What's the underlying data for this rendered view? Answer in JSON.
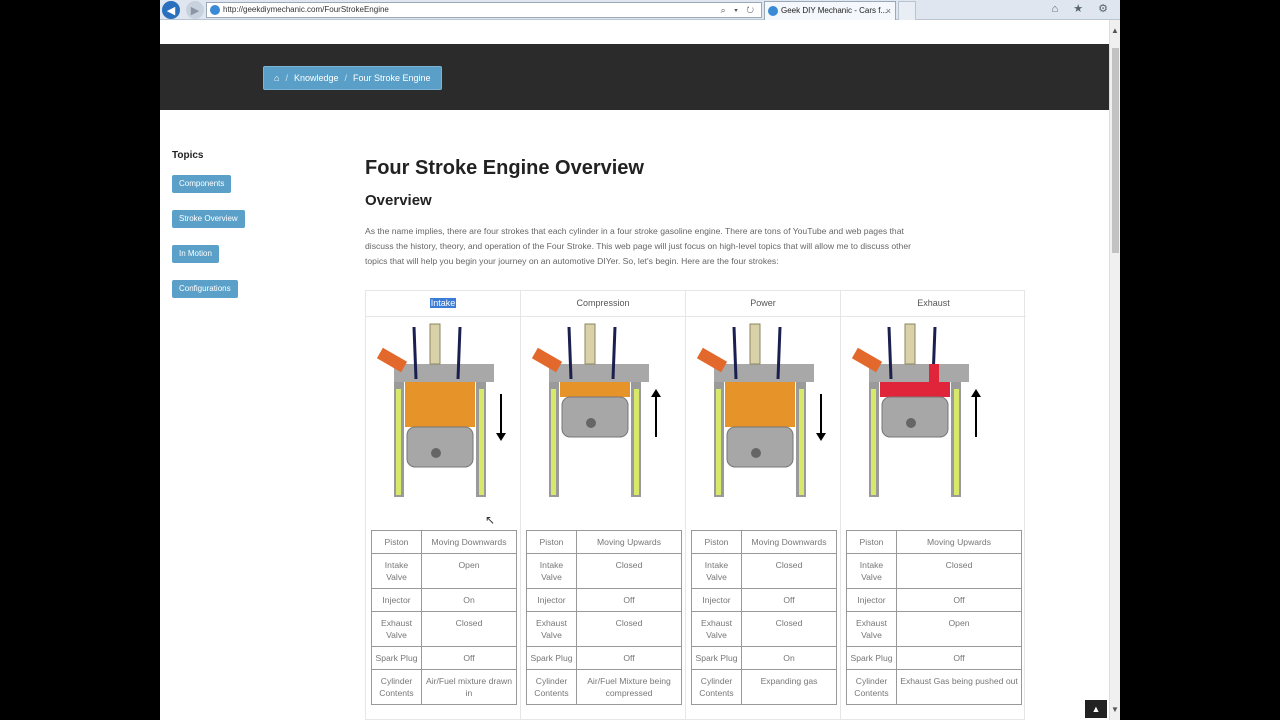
{
  "browser": {
    "url": "http://geekdiymechanic.com/FourStrokeEngine",
    "tab_title": "Geek DIY Mechanic - Cars f...",
    "tab_close": "×",
    "addr_controls": "⌕ ▾ ↻",
    "tools": "⌂ ★ ⚙"
  },
  "breadcrumb": {
    "home_icon": "⌂",
    "items": [
      "Knowledge",
      "Four Stroke Engine"
    ],
    "separator": "/"
  },
  "sidebar": {
    "title": "Topics",
    "buttons": [
      "Components",
      "Stroke Overview",
      "In Motion",
      "Configurations"
    ]
  },
  "main": {
    "title": "Four Stroke Engine Overview",
    "subtitle": "Overview",
    "intro": "As the name implies, there are four strokes that each cylinder in a four stroke gasoline engine. There are tons of YouTube and web pages that discuss the history, theory, and operation of the Four Stroke. This web page will just focus on high-level topics that will allow me to discuss other topics that will help you begin your journey on an automotive DIYer. So, let's begin. Here are the four strokes:"
  },
  "strokes": [
    {
      "name": "Intake",
      "direction": "down",
      "gas_color": "#e6932a",
      "exhaust_open": false,
      "rows": [
        [
          "Piston",
          "Moving Downwards"
        ],
        [
          "Intake Valve",
          "Open"
        ],
        [
          "Injector",
          "On"
        ],
        [
          "Exhaust Valve",
          "Closed"
        ],
        [
          "Spark Plug",
          "Off"
        ],
        [
          "Cylinder Contents",
          "Air/Fuel mixture drawn in"
        ]
      ]
    },
    {
      "name": "Compression",
      "direction": "up",
      "gas_color": "#e6932a",
      "exhaust_open": false,
      "rows": [
        [
          "Piston",
          "Moving Upwards"
        ],
        [
          "Intake Valve",
          "Closed"
        ],
        [
          "Injector",
          "Off"
        ],
        [
          "Exhaust Valve",
          "Closed"
        ],
        [
          "Spark Plug",
          "Off"
        ],
        [
          "Cylinder Contents",
          "Air/Fuel Mixture being compressed"
        ]
      ]
    },
    {
      "name": "Power",
      "direction": "down",
      "gas_color": "#e6932a",
      "exhaust_open": false,
      "rows": [
        [
          "Piston",
          "Moving Downwards"
        ],
        [
          "Intake Valve",
          "Closed"
        ],
        [
          "Injector",
          "Off"
        ],
        [
          "Exhaust Valve",
          "Closed"
        ],
        [
          "Spark Plug",
          "On"
        ],
        [
          "Cylinder Contents",
          "Expanding gas"
        ]
      ]
    },
    {
      "name": "Exhaust",
      "direction": "up",
      "gas_color": "#e0243a",
      "exhaust_open": true,
      "rows": [
        [
          "Piston",
          "Moving Upwards"
        ],
        [
          "Intake Valve",
          "Closed"
        ],
        [
          "Injector",
          "Off"
        ],
        [
          "Exhaust Valve",
          "Open"
        ],
        [
          "Spark Plug",
          "Off"
        ],
        [
          "Cylinder Contents",
          "Exhaust Gas being pushed out"
        ]
      ]
    }
  ],
  "scroll_top_icon": "▲"
}
